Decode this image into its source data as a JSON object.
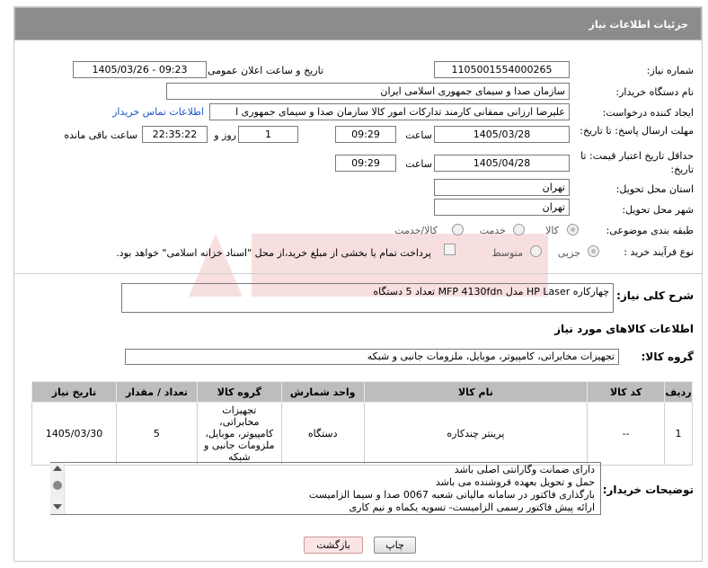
{
  "page_title": "جزئیات اطلاعات نیاز",
  "fields": {
    "need_number_label": "شماره نیاز:",
    "need_number": "1105001554000265",
    "announce_label": "تاریخ و ساعت اعلان عمومی:",
    "announce_value": "1405/03/26 - 09:23",
    "buyer_org_label": "نام دستگاه خریدار:",
    "buyer_org": "سازمان صدا و سیمای جمهوری اسلامی ایران",
    "requester_label": "ایجاد کننده درخواست:",
    "requester": "علیرضا ارزانی ممقانی کارمند تدارکات امور کالا سازمان صدا و سیمای جمهوری ا",
    "buyer_contact_link": "اطلاعات تماس خریدار",
    "deadline_label": "مهلت ارسال پاسخ: تا تاریخ:",
    "deadline_date": "1405/03/28",
    "time_label": "ساعت",
    "deadline_time": "09:29",
    "day_label": "روز و",
    "days_remaining": "1",
    "remaining_time": "22:35:22",
    "remaining_label": "ساعت باقی مانده",
    "validity_label": "حداقل تاریخ اعتبار قیمت: تا تاریخ:",
    "validity_date": "1405/04/28",
    "validity_time": "09:29",
    "province_label": "استان محل تحویل:",
    "province": "تهران",
    "city_label": "شهر محل تحویل:",
    "city": "تهران",
    "category_label": "طبقه بندی موضوعی:",
    "category_options": [
      "کالا",
      "خدمت",
      "کالا/خدمت"
    ],
    "process_label": "نوع فرآیند خرید :",
    "process_options": [
      "جزیی",
      "متوسط"
    ],
    "payment_note": "پرداخت تمام یا بخشی از مبلغ خرید،از محل \"اسناد خزانه اسلامی\" خواهد بود."
  },
  "description": {
    "label": "شرح کلی نیاز:",
    "text": "چهارکاره HP Laser مدل MFP 4130fdn     تعداد 5 دستگاه"
  },
  "goods_info_title": "اطلاعات کالاهای مورد نیاز",
  "goods_group": {
    "label": "گروه کالا:",
    "value": "تجهیزات مخابراتی، کامپیوتر، موبایل، ملزومات جانبی و شبکه"
  },
  "table": {
    "headers": [
      "ردیف",
      "کد کالا",
      "نام کالا",
      "واحد شمارش",
      "گروه کالا",
      "تعداد / مقدار",
      "تاریخ نیاز"
    ],
    "rows": [
      [
        "1",
        "--",
        "پرینتر چندکاره",
        "دستگاه",
        "تجهیزات مخابراتی، کامپیوتر، موبایل، ملزومات جانبی و شبکه",
        "5",
        "1405/03/30"
      ]
    ]
  },
  "buyer_notes": {
    "label": "توضیحات خریدار:",
    "lines": [
      "دارای ضمانت وگارانتی اصلی باشد",
      "حمل و تحویل بعهده فروشنده می باشد",
      "بارگذاری فاکتور در سامانه مالیاتی شعبه 0067 صدا و سیما الزامیست",
      "ارائه پیش فاکتور رسمی الزامیست- تسویه یکماه و نیم کاری"
    ]
  },
  "buttons": {
    "print": "چاپ",
    "back": "بازگشت"
  },
  "colors": {
    "titlebar": "#8c8c8c",
    "table_header": "#bdbdbd",
    "link": "#1a55c7",
    "back_button_bg": "#fbe4e4"
  }
}
